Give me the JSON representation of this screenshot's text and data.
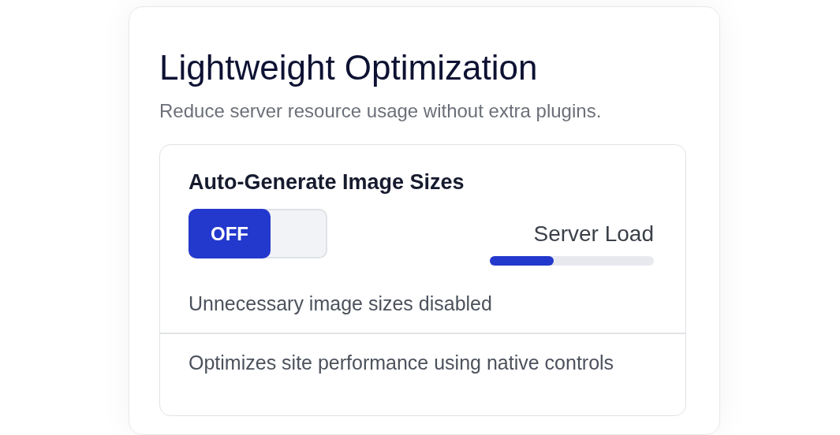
{
  "card": {
    "title": "Lightweight Optimization",
    "subtitle": "Reduce server resource usage without extra plugins."
  },
  "setting": {
    "title": "Auto-Generate Image Sizes",
    "toggle": {
      "label": "OFF",
      "on": false
    },
    "meter": {
      "label": "Server Load",
      "level": 0.39
    },
    "status": "Unnecessary image sizes disabled"
  },
  "footer_note": "Optimizes site performance using native controls"
}
